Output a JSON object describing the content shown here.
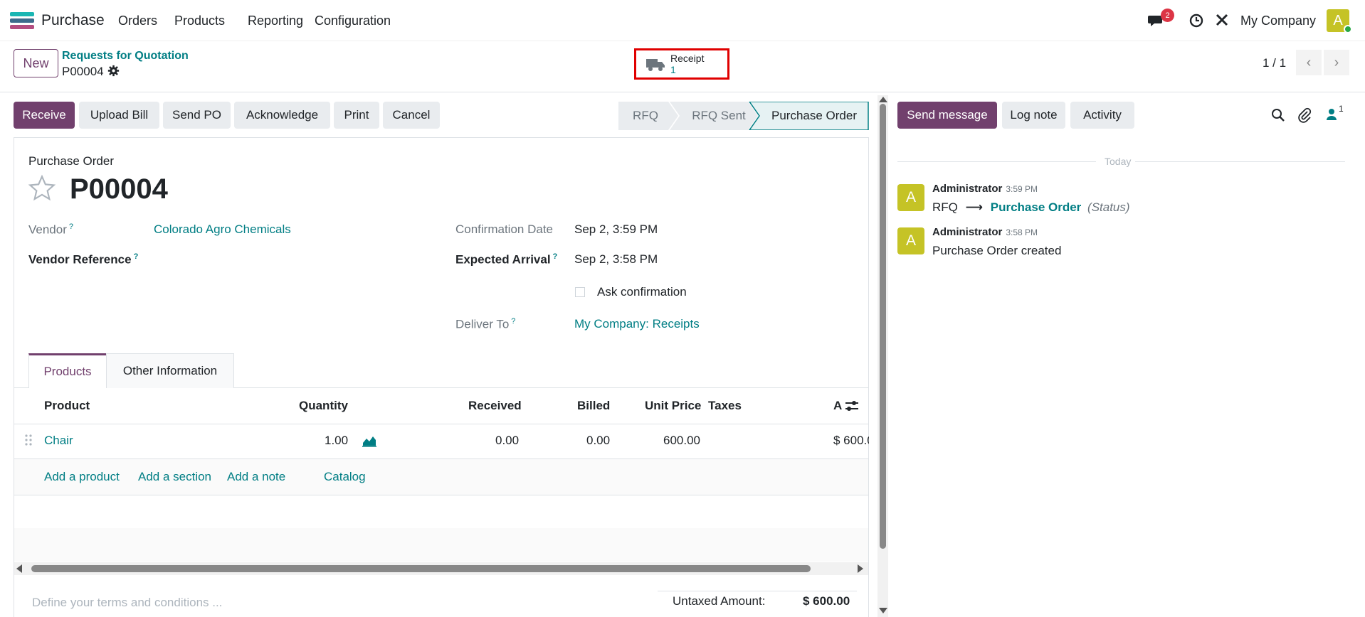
{
  "navbar": {
    "app_name": "Purchase",
    "menu": [
      "Orders",
      "Products",
      "Reporting",
      "Configuration"
    ],
    "messages_badge": "2",
    "company": "My Company",
    "user_initial": "A"
  },
  "control": {
    "new_label": "New",
    "breadcrumb": "Requests for Quotation",
    "record": "P00004",
    "smart_button": {
      "label": "Receipt",
      "value": "1"
    },
    "pager": "1 / 1"
  },
  "actions": [
    "Receive",
    "Upload Bill",
    "Send PO",
    "Acknowledge",
    "Print",
    "Cancel"
  ],
  "stages": [
    "RFQ",
    "RFQ Sent",
    "Purchase Order"
  ],
  "form": {
    "doc_type": "Purchase Order",
    "name": "P00004",
    "vendor_label": "Vendor",
    "vendor": "Colorado Agro Chemicals",
    "vendor_ref_label": "Vendor Reference",
    "confirmation_label": "Confirmation Date",
    "confirmation": "Sep 2, 3:59 PM",
    "expected_label": "Expected Arrival",
    "expected": "Sep 2, 3:58 PM",
    "ask_confirmation": "Ask confirmation",
    "deliver_label": "Deliver To",
    "deliver": "My Company: Receipts",
    "q": "?"
  },
  "tabs": [
    "Products",
    "Other Information"
  ],
  "table": {
    "headers": [
      "Product",
      "Quantity",
      "Received",
      "Billed",
      "Unit Price",
      "Taxes",
      "A"
    ],
    "rows": [
      {
        "product": "Chair",
        "quantity": "1.00",
        "received": "0.00",
        "billed": "0.00",
        "unit_price": "600.00",
        "taxes": "",
        "amount": "$ 600.0"
      }
    ],
    "add_links": [
      "Add a product",
      "Add a section",
      "Add a note",
      "Catalog"
    ]
  },
  "footer": {
    "terms_placeholder": "Define your terms and conditions ...",
    "untaxed_label": "Untaxed Amount:",
    "untaxed_value": "$ 600.00"
  },
  "chatter": {
    "buttons": [
      "Send message",
      "Log note",
      "Activity"
    ],
    "followers_count": "1",
    "today": "Today",
    "messages": [
      {
        "initial": "A",
        "author": "Administrator",
        "time": "3:59 PM",
        "from": "RFQ",
        "to": "Purchase Order",
        "field": "(Status)"
      },
      {
        "initial": "A",
        "author": "Administrator",
        "time": "3:58 PM",
        "body": "Purchase Order created"
      }
    ]
  },
  "colors": {
    "brand": "#71406d",
    "link": "#017e84",
    "highlight": "#e00000"
  }
}
